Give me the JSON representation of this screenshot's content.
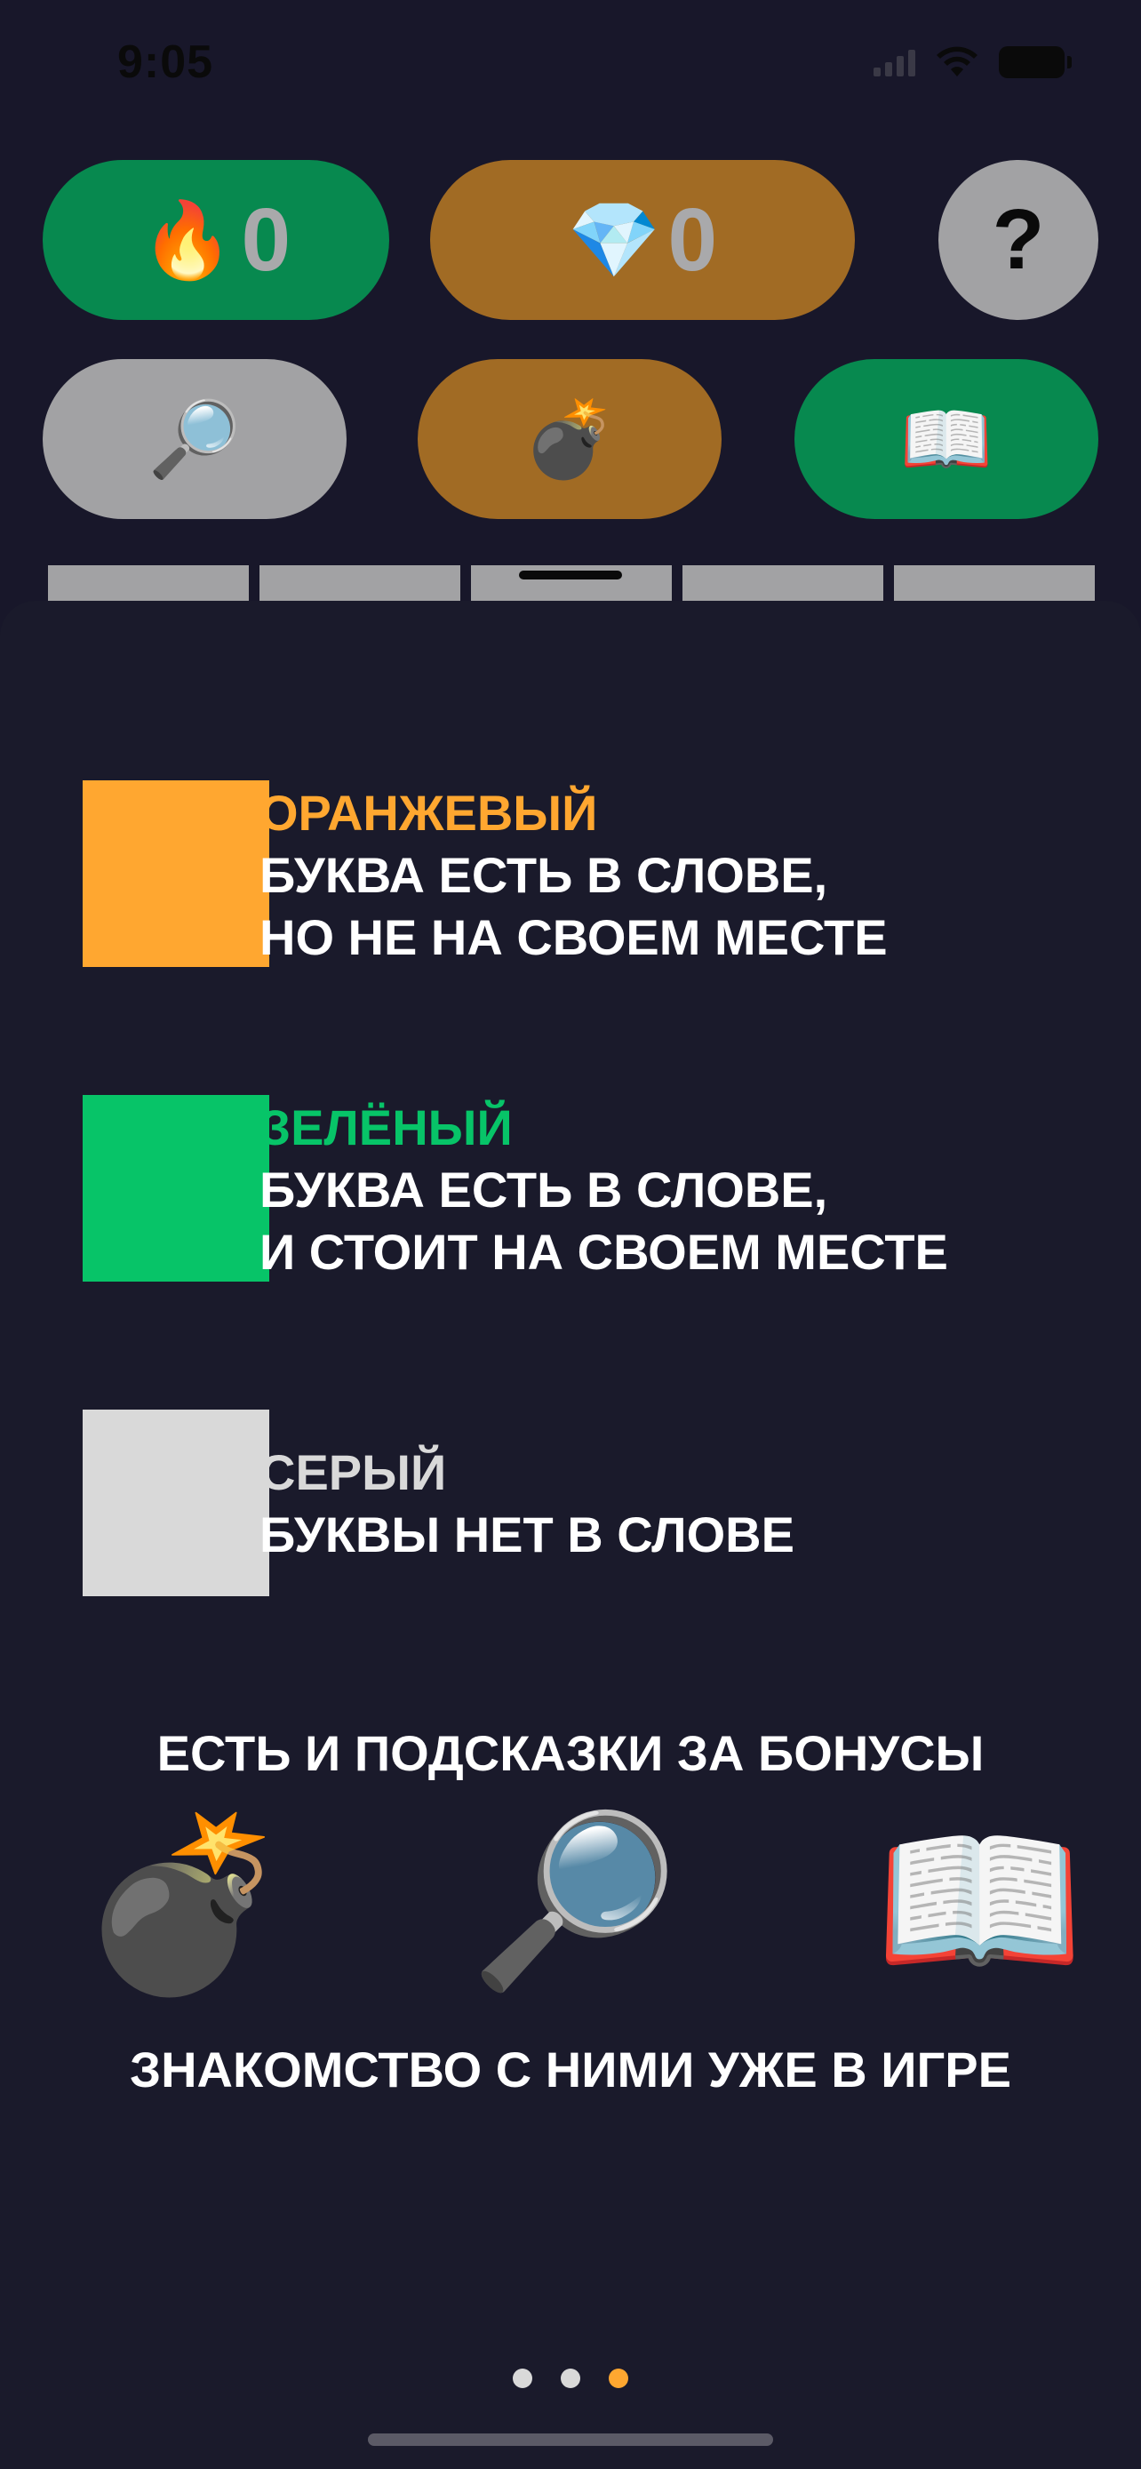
{
  "status_bar": {
    "time": "9:05"
  },
  "top_bar": {
    "streak": {
      "icon": "🔥",
      "icon_name": "fire-icon",
      "value": "0"
    },
    "gems": {
      "icon": "💎",
      "icon_name": "diamond-icon",
      "value": "0"
    },
    "help": {
      "label": "?"
    }
  },
  "hint_buttons": [
    {
      "icon": "🔎",
      "icon_name": "magnifier-icon"
    },
    {
      "icon": "💣",
      "icon_name": "bomb-icon"
    },
    {
      "icon": "📖",
      "icon_name": "open-book-icon"
    }
  ],
  "legend": [
    {
      "color_name": "ОРАНЖЕВЫЙ",
      "color": "#ffa730",
      "line1": "БУКВА ЕСТЬ В СЛОВЕ,",
      "line2": "НО НЕ НА СВОЕМ МЕСТЕ"
    },
    {
      "color_name": "ЗЕЛЁНЫЙ",
      "color": "#07c468",
      "line1": "БУКВА ЕСТЬ В СЛОВЕ,",
      "line2": "И СТОИТ НА СВОЕМ МЕСТЕ"
    },
    {
      "color_name": "СЕРЫЙ",
      "color": "#d9d9d9",
      "line1": "БУКВЫ НЕТ В СЛОВЕ",
      "line2": ""
    }
  ],
  "hints_section": {
    "heading": "ЕСТЬ И ПОДСКАЗКИ ЗА БОНУСЫ",
    "icons": [
      {
        "icon": "💣",
        "icon_name": "bomb-icon"
      },
      {
        "icon": "🔎",
        "icon_name": "magnifier-icon"
      },
      {
        "icon": "📖",
        "icon_name": "open-book-icon"
      }
    ],
    "footer": "ЗНАКОМСТВО С НИМИ УЖЕ В ИГРЕ"
  },
  "pagination": {
    "total": 3,
    "current": 3,
    "active_color": "#ffa730",
    "inactive_color": "#d9d9d9"
  },
  "colors": {
    "background": "#18172a",
    "green_button": "#07894f",
    "orange_button": "#a16b24",
    "gray_button": "#a2a2a4"
  }
}
